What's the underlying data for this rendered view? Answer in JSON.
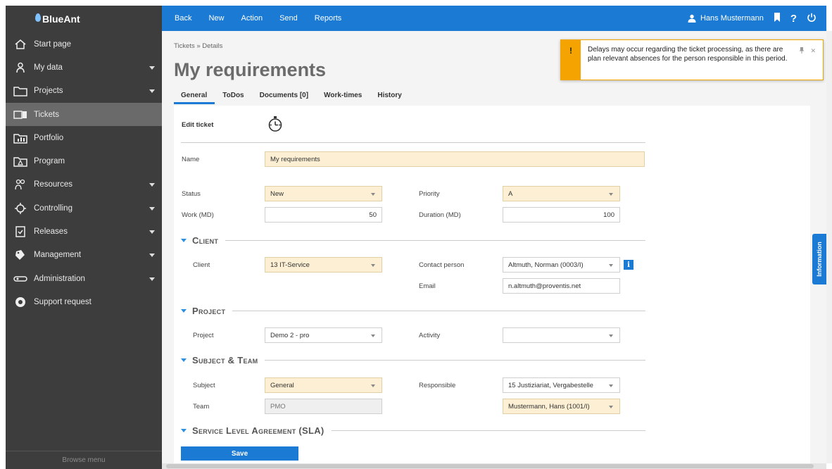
{
  "app": {
    "name": "BlueAnt"
  },
  "sidebar": {
    "items": [
      {
        "label": "Start page",
        "icon": "home-icon",
        "caret": false
      },
      {
        "label": "My data",
        "icon": "person-icon",
        "caret": true
      },
      {
        "label": "Projects",
        "icon": "folder-icon",
        "caret": true
      },
      {
        "label": "Tickets",
        "icon": "ticket-icon",
        "caret": false,
        "active": true
      },
      {
        "label": "Portfolio",
        "icon": "portfolio-icon",
        "caret": false
      },
      {
        "label": "Program",
        "icon": "program-icon",
        "caret": false
      },
      {
        "label": "Resources",
        "icon": "resources-icon",
        "caret": true
      },
      {
        "label": "Controlling",
        "icon": "controlling-icon",
        "caret": true
      },
      {
        "label": "Releases",
        "icon": "releases-icon",
        "caret": true
      },
      {
        "label": "Management",
        "icon": "management-icon",
        "caret": true
      },
      {
        "label": "Administration",
        "icon": "administration-icon",
        "caret": true
      },
      {
        "label": "Support request",
        "icon": "support-icon",
        "caret": false
      }
    ],
    "browse_label": "Browse menu"
  },
  "topbar": {
    "items": [
      "Back",
      "New",
      "Action",
      "Send",
      "Reports"
    ],
    "user": "Hans Mustermann"
  },
  "breadcrumb": "Tickets » Details",
  "page_title": "My requirements",
  "tabs": [
    "General",
    "ToDos",
    "Documents [0]",
    "Work-times",
    "History"
  ],
  "form": {
    "edit_ticket_label": "Edit ticket",
    "name_label": "Name",
    "name_value": "My requirements",
    "status_label": "Status",
    "status_value": "New",
    "priority_label": "Priority",
    "priority_value": "A",
    "work_label": "Work (MD)",
    "work_value": "50",
    "duration_label": "Duration (MD)",
    "duration_value": "100",
    "client_section": "Client",
    "client_label": "Client",
    "client_value": "13 IT-Service",
    "contact_label": "Contact person",
    "contact_value": "Altmuth, Norman (0003/I)",
    "email_label": "Email",
    "email_value": "n.altmuth@proventis.net",
    "project_section": "Project",
    "project_label": "Project",
    "project_value": "Demo 2 - pro",
    "activity_label": "Activity",
    "activity_value": "",
    "subject_section": "Subject & Team",
    "subject_label": "Subject",
    "subject_value": "General",
    "responsible_label": "Responsible",
    "responsible_value": "15 Justiziariat, Vergabestelle",
    "team_label": "Team",
    "team_value": "PMO",
    "team2_value": "Mustermann, Hans (1001/I)",
    "sla_section": "Service Level Agreement (SLA)",
    "save_label": "Save"
  },
  "info_tab": "Information",
  "toast": {
    "message": "Delays may occur regarding the ticket processing, as there are plan relevant absences for the person responsible in this period.",
    "icon": "!"
  },
  "colors": {
    "accent": "#1a7ad4",
    "sidebar_bg": "#3d3d3d",
    "required_bg": "#fcefd3",
    "warning": "#f5a300"
  }
}
